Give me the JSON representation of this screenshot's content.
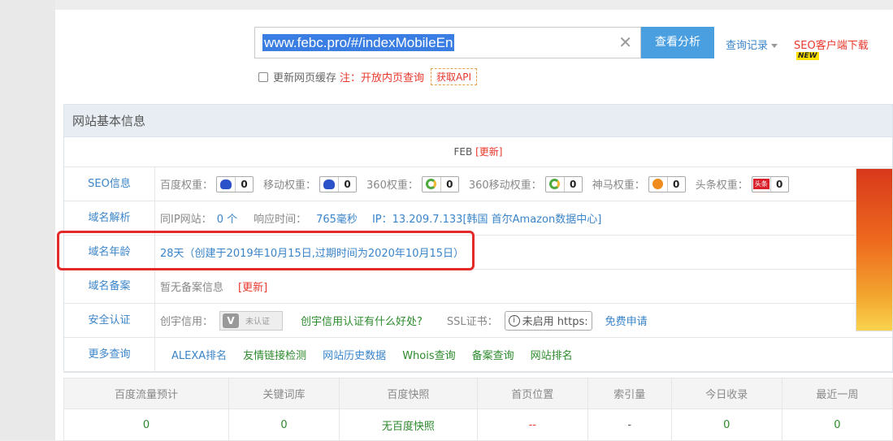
{
  "search": {
    "value": "www.febc.pro/#/indexMobileEn",
    "button": "查看分析",
    "clear_icon": "close-icon"
  },
  "header_links": {
    "history": "查询记录",
    "seo_download": "SEO客户端下载",
    "new_badge": "NEW"
  },
  "options": {
    "refresh_cache": "更新网页缓存",
    "note": "注：开放内页查询",
    "api": "获取API"
  },
  "panel": {
    "title": "网站基本信息",
    "site_name": "FEB",
    "update_link": "[更新]",
    "rows": {
      "seo": {
        "label": "SEO信息",
        "weights": [
          {
            "name": "百度权重：",
            "value": "0",
            "icon": "baidu-paw-icon"
          },
          {
            "name": "移动权重：",
            "value": "0",
            "icon": "baidu-paw-icon"
          },
          {
            "name": "360权重：",
            "value": "0",
            "icon": "360-icon"
          },
          {
            "name": "360移动权重：",
            "value": "0",
            "icon": "360-icon"
          },
          {
            "name": "神马权重：",
            "value": "0",
            "icon": "shenma-icon"
          },
          {
            "name": "头条权重：",
            "value": "0",
            "icon": "toutiao-icon"
          }
        ],
        "toutiao_icon_text": "头条"
      },
      "dns": {
        "label": "域名解析",
        "same_ip": "同IP网站：",
        "same_ip_value": "0 个",
        "resp_label": "响应时间：",
        "resp_value": "765毫秒",
        "ip": "IP：13.209.7.133[韩国 首尔Amazon数据中心]"
      },
      "age": {
        "label": "域名年龄",
        "value": "28天（创建于2019年10月15日,过期时间为2020年10月15日）"
      },
      "icp": {
        "label": "域名备案",
        "value": "暂无备案信息",
        "update": "[更新]"
      },
      "security": {
        "label": "安全认证",
        "credit": "创宇信用：",
        "credit_badge": "未认证",
        "credit_letter": "V",
        "credit_link": "创宇信用认证有什么好处?",
        "ssl": "SSL证书：",
        "ssl_status": "未启用 https:",
        "apply": "免费申请"
      },
      "more": {
        "label": "更多查询",
        "links": [
          "ALEXA排名",
          "友情链接检测",
          "网站历史数据",
          "Whois查询",
          "备案查询",
          "网站排名"
        ]
      }
    }
  },
  "stats": {
    "headers": [
      "百度流量预计",
      "关键词库",
      "百度快照",
      "首页位置",
      "索引量",
      "今日收录",
      "最近一周"
    ],
    "values": [
      "0",
      "0",
      "无百度快照",
      "--",
      "-",
      "0",
      "0"
    ]
  },
  "colors": {
    "accent": "#4a9fe0",
    "link": "#3a84c9",
    "alert": "#e8382b",
    "highlight": "#e32a2a"
  }
}
